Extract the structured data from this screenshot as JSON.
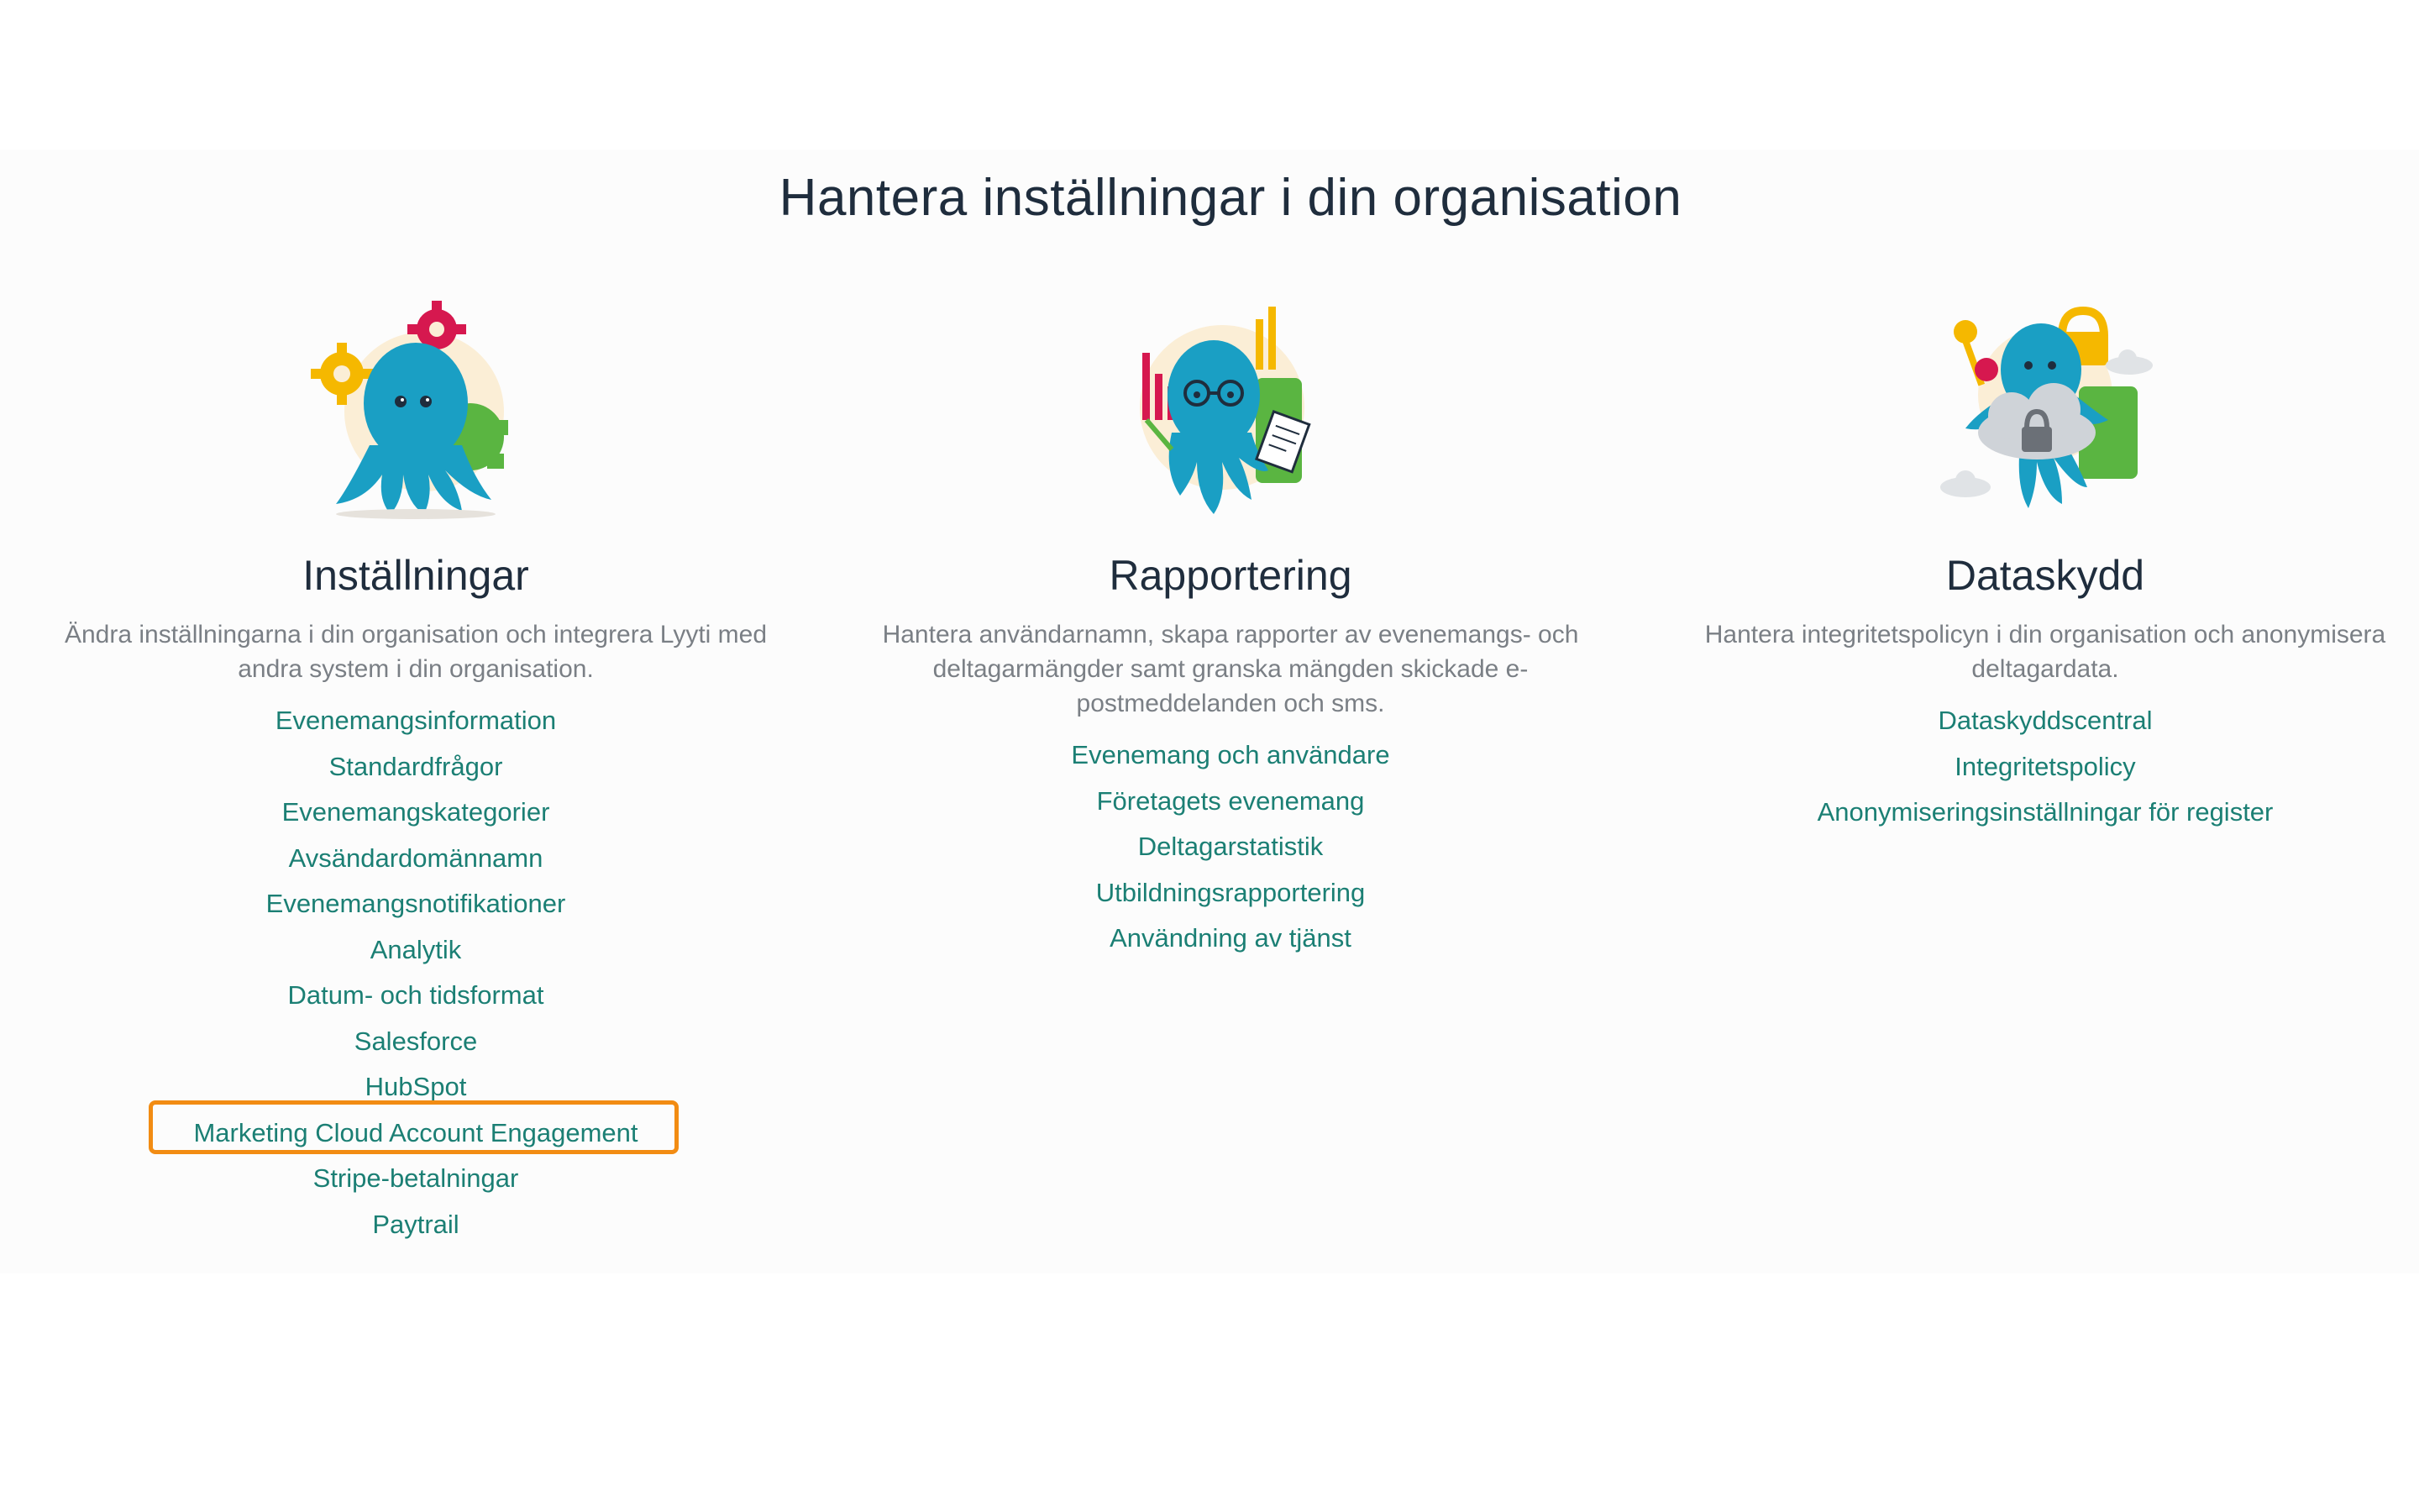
{
  "page": {
    "title": "Hantera inställningar i din organisation"
  },
  "columns": [
    {
      "heading": "Inställningar",
      "description": "Ändra inställningarna i din organisation och integrera Lyyti med andra system i din organisation.",
      "illustration": "settings-octopus-gears-illustration",
      "links": [
        "Evenemangsinformation",
        "Standardfrågor",
        "Evenemangskategorier",
        "Avsändardomännamn",
        "Evenemangsnotifikationer",
        "Analytik",
        "Datum- och tidsformat",
        "Salesforce",
        "HubSpot",
        "Marketing Cloud Account Engagement",
        "Stripe-betalningar",
        "Paytrail"
      ]
    },
    {
      "heading": "Rapportering",
      "description": "Hantera användarnamn, skapa rapporter av evenemangs- och deltagarmängder samt granska mängden skickade e-postmeddelanden och sms.",
      "illustration": "reporting-octopus-charts-illustration",
      "links": [
        "Evenemang och användare",
        "Företagets evenemang",
        "Deltagarstatistik",
        "Utbildningsrapportering",
        "Användning av tjänst"
      ]
    },
    {
      "heading": "Dataskydd",
      "description": "Hantera integritetspolicyn i din organisation och anonymisera deltagardata.",
      "illustration": "data-protection-octopus-lock-illustration",
      "links": [
        "Dataskyddscentral",
        "Integritetspolicy",
        "Anonymiseringsinställningar för register"
      ]
    }
  ],
  "highlight": {
    "target": "Marketing Cloud Account Engagement",
    "color": "#f28c13"
  },
  "colors": {
    "link": "#1b7f74",
    "heading": "#1f2d3d",
    "description": "#7a7f85",
    "octopus": "#1a9fc4",
    "highlight": "#f28c13"
  }
}
